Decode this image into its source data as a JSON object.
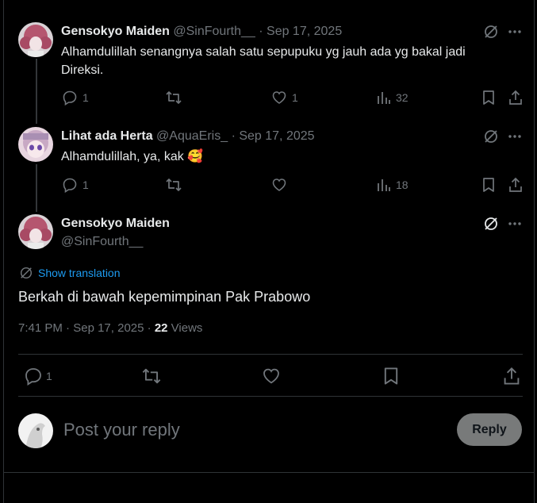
{
  "tweets": [
    {
      "name": "Gensokyo Maiden",
      "handle": "@SinFourth__",
      "date": "Sep 17, 2025",
      "text": "Alhamdulillah senangnya salah satu sepupuku yg jauh ada yg bakal jadi Direksi.",
      "replies": "1",
      "likes": "1",
      "views": "32"
    },
    {
      "name": "Lihat ada Herta",
      "handle": "@AquaEris_",
      "date": "Sep 17, 2025",
      "text": "Alhamdulillah, ya, kak",
      "emoji": "🥰",
      "replies": "1",
      "views": "18"
    }
  ],
  "main_tweet": {
    "name": "Gensokyo Maiden",
    "handle": "@SinFourth__",
    "translate_label": "Show translation",
    "text": "Berkah di bawah kepemimpinan Pak Prabowo",
    "time": "7:41 PM",
    "date": "Sep 17, 2025",
    "views_count": "22",
    "views_label": "Views",
    "replies": "1"
  },
  "reply_box": {
    "placeholder": "Post your reply",
    "button": "Reply"
  },
  "colors": {
    "background": "#000000",
    "text": "#e7e9ea",
    "muted": "#71767b",
    "link": "#1d9bf0",
    "border": "#2f3336"
  }
}
